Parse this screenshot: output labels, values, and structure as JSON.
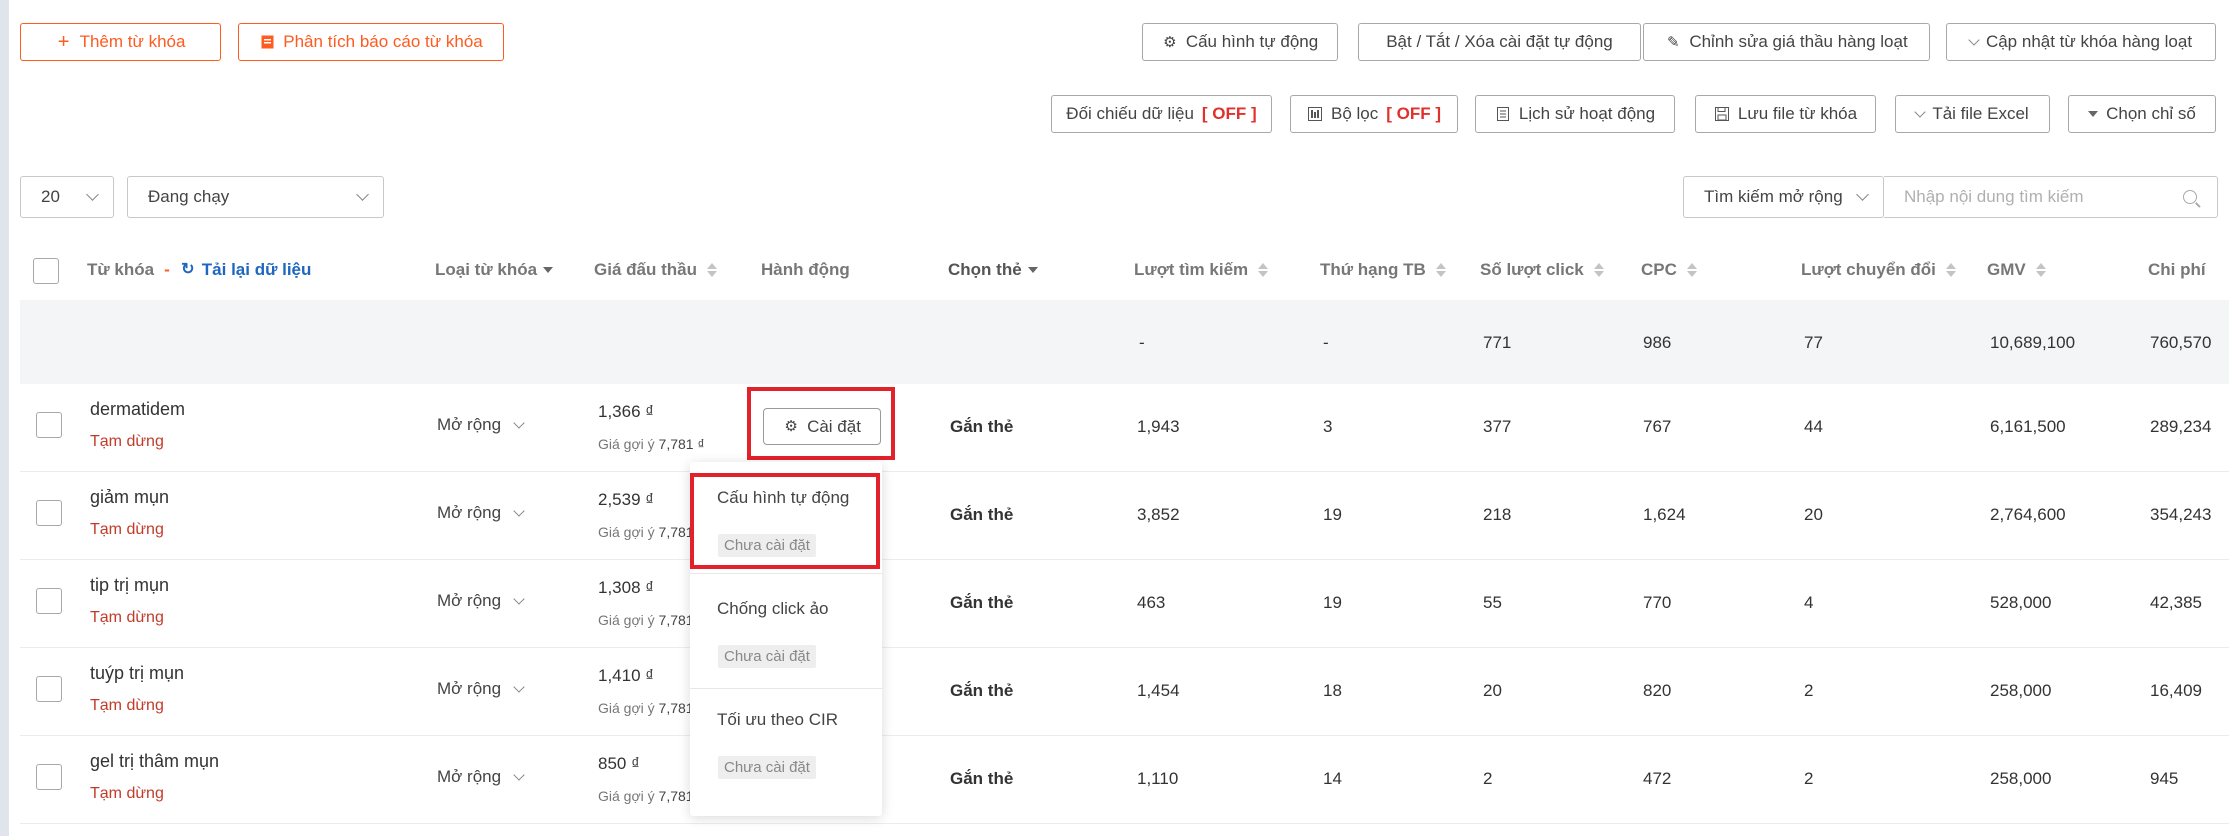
{
  "toolbar": {
    "add_keyword": "Thêm từ khóa",
    "analyze_report": "Phân tích báo cáo từ khóa",
    "auto_config": "Cấu hình tự động",
    "toggle_auto": "Bật / Tắt / Xóa cài đặt tự động",
    "bulk_bid": "Chỉnh sửa giá thầu hàng loạt",
    "bulk_update": "Cập nhật từ khóa hàng loạt",
    "compare_data": "Đối chiếu dữ liệu",
    "compare_state": "[ OFF ]",
    "filter": "Bộ lọc",
    "filter_state": "[ OFF ]",
    "history": "Lịch sử hoạt động",
    "save_file": "Lưu file từ khóa",
    "download_excel": "Tải file Excel",
    "choose_metric": "Chọn chỉ số"
  },
  "controls": {
    "page_size": "20",
    "status_filter": "Đang chạy",
    "search_scope": "Tìm kiếm mở rộng",
    "search_placeholder": "Nhập nội dung tìm kiếm"
  },
  "columns": {
    "keyword": "Từ khóa",
    "dash": "-",
    "reload": "Tải lại dữ liệu",
    "type": "Loại từ khóa",
    "bid": "Giá đấu thầu",
    "action": "Hành động",
    "tag": "Chọn thẻ",
    "searches": "Lượt tìm kiếm",
    "rank": "Thứ hạng TB",
    "clicks": "Số lượt click",
    "cpc": "CPC",
    "conversions": "Lượt chuyển đổi",
    "gmv": "GMV",
    "cost": "Chi phí"
  },
  "totals": {
    "searches": "-",
    "rank": "-",
    "clicks": "771",
    "cpc": "986",
    "conversions": "77",
    "gmv": "10,689,100",
    "cost": "760,570"
  },
  "rows": [
    {
      "keyword": "dermatidem",
      "status": "Tạm dừng",
      "type": "Mở rộng",
      "bid": "1,366 ₫",
      "hint_label": "Giá gợi ý",
      "hint_value": "7,781 ₫",
      "tag": "Gắn thẻ",
      "searches": "1,943",
      "rank": "3",
      "clicks": "377",
      "cpc": "767",
      "conversions": "44",
      "gmv": "6,161,500",
      "cost": "289,234"
    },
    {
      "keyword": "giảm mụn",
      "status": "Tạm dừng",
      "type": "Mở rộng",
      "bid": "2,539 ₫",
      "hint_label": "Giá gợi ý",
      "hint_value": "7,781",
      "tag": "Gắn thẻ",
      "searches": "3,852",
      "rank": "19",
      "clicks": "218",
      "cpc": "1,624",
      "conversions": "20",
      "gmv": "2,764,600",
      "cost": "354,243"
    },
    {
      "keyword": "tip trị mụn",
      "status": "Tạm dừng",
      "type": "Mở rộng",
      "bid": "1,308 ₫",
      "hint_label": "Giá gợi ý",
      "hint_value": "7,781",
      "tag": "Gắn thẻ",
      "searches": "463",
      "rank": "19",
      "clicks": "55",
      "cpc": "770",
      "conversions": "4",
      "gmv": "528,000",
      "cost": "42,385"
    },
    {
      "keyword": "tuýp trị mụn",
      "status": "Tạm dừng",
      "type": "Mở rộng",
      "bid": "1,410 ₫",
      "hint_label": "Giá gợi ý",
      "hint_value": "7,781",
      "tag": "Gắn thẻ",
      "searches": "1,454",
      "rank": "18",
      "clicks": "20",
      "cpc": "820",
      "conversions": "2",
      "gmv": "258,000",
      "cost": "16,409"
    },
    {
      "keyword": "gel trị thâm mụn",
      "status": "Tạm dừng",
      "type": "Mở rộng",
      "bid": "850 ₫",
      "hint_label": "Giá gợi ý",
      "hint_value": "7,781",
      "tag": "Gắn thẻ",
      "searches": "1,110",
      "rank": "14",
      "clicks": "2",
      "cpc": "472",
      "conversions": "2",
      "gmv": "258,000",
      "cost": "945"
    }
  ],
  "action_button": "Cài đặt",
  "dropdown": {
    "items": [
      {
        "title": "Cấu hình tự động",
        "tag": "Chưa cài đặt"
      },
      {
        "title": "Chống click ảo",
        "tag": "Chưa cài đặt"
      },
      {
        "title": "Tối ưu theo CIR",
        "tag": "Chưa cài đặt"
      }
    ]
  }
}
